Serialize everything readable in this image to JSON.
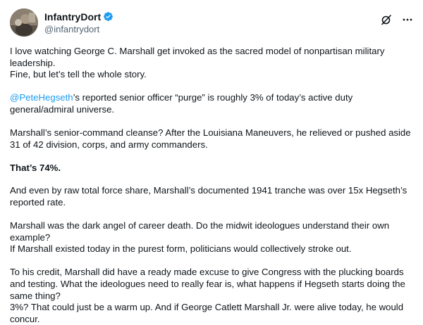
{
  "author": {
    "display_name": "InfantryDort",
    "handle": "@infantrydort"
  },
  "icons": {
    "verified": "verified-badge-icon",
    "grok": "grok-icon",
    "more": "more-options-icon"
  },
  "colors": {
    "accent": "#1d9bf0",
    "text": "#0f1419",
    "secondary": "#536471"
  },
  "paragraphs": [
    {
      "text": "I love watching George C. Marshall get invoked as the sacred model of nonpartisan military leadership."
    },
    {
      "text": "Fine, but let’s tell the whole story."
    },
    {
      "mention": "@PeteHegseth",
      "text": "’s reported senior officer “purge” is roughly 3% of today’s active duty general/admiral universe."
    },
    {
      "text": "Marshall’s senior-command cleanse? After the Louisiana Maneuvers, he relieved or pushed aside 31 of 42 division, corps, and army commanders."
    },
    {
      "text": "That’s 74%."
    },
    {
      "text": "And even by raw total force share, Marshall’s documented 1941 tranche was over 15x Hegseth’s reported rate."
    },
    {
      "text": "Marshall was the dark angel of career death. Do the midwit ideologues understand their own example?"
    },
    {
      "text": "If Marshall existed today in the purest form, politicians would collectively stroke out."
    },
    {
      "text": "To his credit, Marshall did have a ready made excuse to give Congress with the plucking boards and testing. What the ideologues need to really fear is, what happens if Hegseth starts doing the same thing?"
    },
    {
      "text": "3%?  That could just be a warm up. And if George Catlett Marshall Jr. were alive today, he would concur."
    }
  ]
}
